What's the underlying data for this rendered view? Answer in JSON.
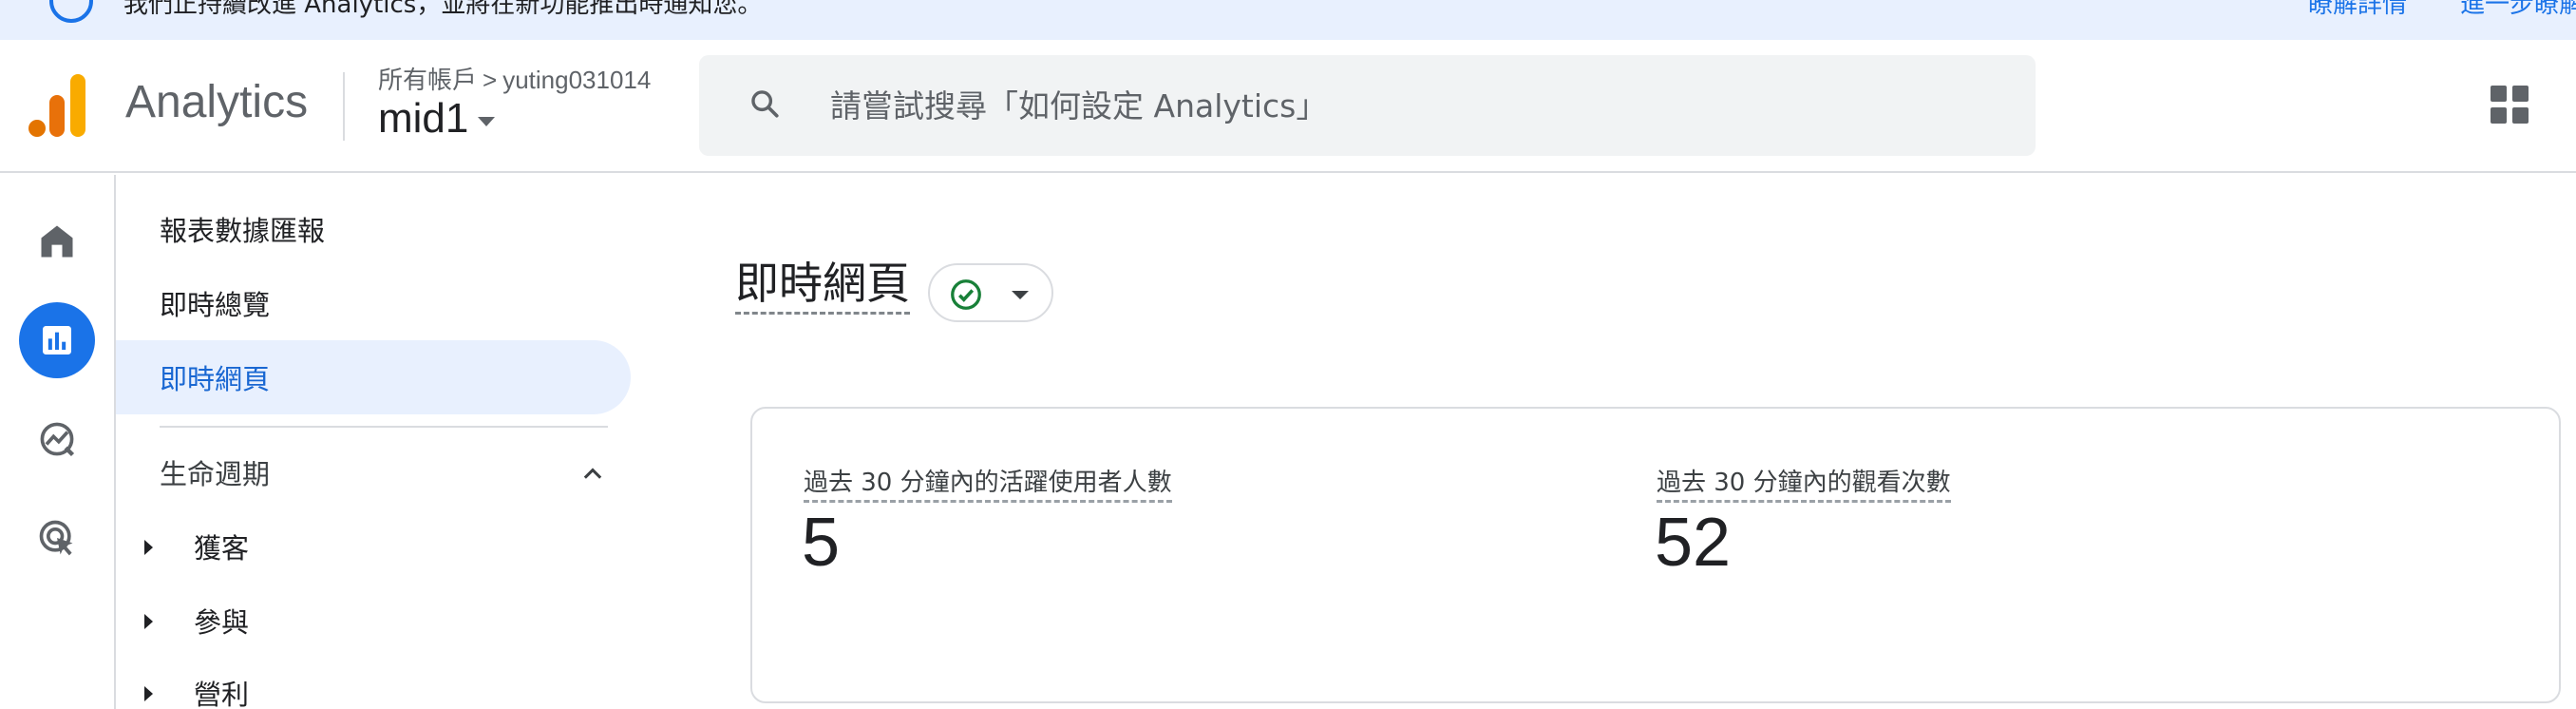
{
  "banner": {
    "text": "我們正持續改進 Analytics，並將在新功能推出時通知您。",
    "link1": "瞭解詳情",
    "link2": "進一步瞭解"
  },
  "header": {
    "app_name": "Analytics",
    "breadcrumb_root": "所有帳戶",
    "breadcrumb_account": "yuting031014",
    "property_name": "mid1",
    "search_placeholder": "請嘗試搜尋「如何設定 Analytics」"
  },
  "nav": {
    "section_title": "報表數據匯報",
    "items": [
      {
        "label": "即時總覽"
      },
      {
        "label": "即時網頁"
      }
    ],
    "lifecycle_label": "生命週期",
    "lifecycle_items": [
      {
        "label": "獲客"
      },
      {
        "label": "參與"
      },
      {
        "label": "營利"
      }
    ]
  },
  "main": {
    "title": "即時網頁",
    "status": "check-circle-icon"
  },
  "metrics": [
    {
      "label": "過去 30 分鐘內的活躍使用者人數",
      "value": "5"
    },
    {
      "label": "過去 30 分鐘內的觀看次數",
      "value": "52"
    }
  ],
  "colors": {
    "accent": "#1a73e8",
    "active_bg": "#e8f0fe",
    "success": "#188038"
  }
}
